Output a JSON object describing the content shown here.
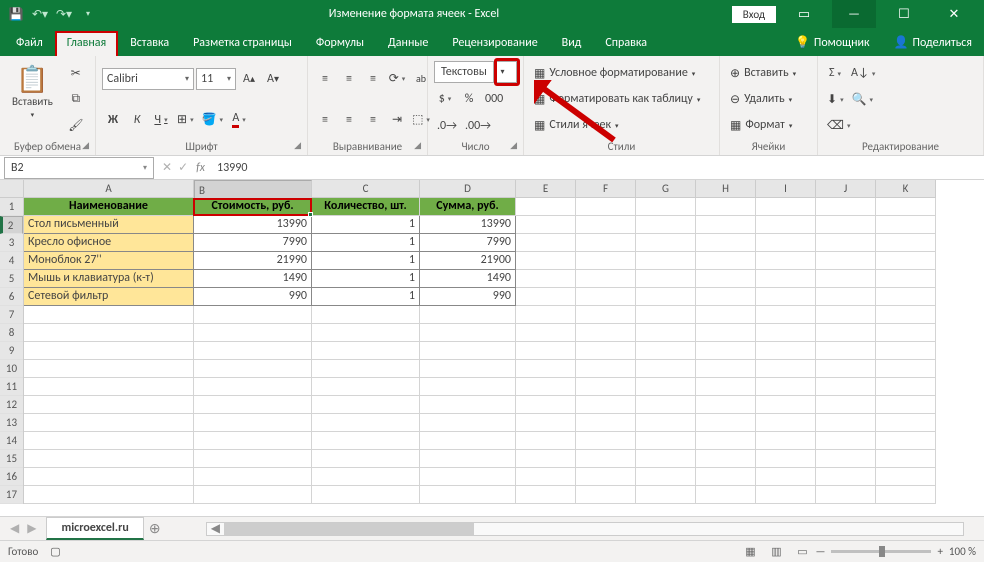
{
  "title": "Изменение формата ячеек  -  Excel",
  "login": "Вход",
  "tabs": {
    "file": "Файл",
    "home": "Главная",
    "insert": "Вставка",
    "layout": "Разметка страницы",
    "formulas": "Формулы",
    "data": "Данные",
    "review": "Рецензирование",
    "view": "Вид",
    "help": "Справка",
    "tell": "Помощник",
    "share": "Поделиться"
  },
  "ribbon": {
    "clipboard": {
      "paste": "Вставить",
      "label": "Буфер обмена"
    },
    "font": {
      "name": "Calibri",
      "size": "11",
      "label": "Шрифт",
      "bold": "Ж",
      "italic": "К",
      "underline": "Ч"
    },
    "align": {
      "label": "Выравнивание"
    },
    "number": {
      "format": "Текстовы",
      "label": "Число"
    },
    "styles": {
      "cond": "Условное форматирование",
      "table": "Форматировать как таблицу",
      "cell": "Стили ячеек",
      "label": "Стили"
    },
    "cells": {
      "insert": "Вставить",
      "delete": "Удалить",
      "format": "Формат",
      "label": "Ячейки"
    },
    "editing": {
      "label": "Редактирование"
    }
  },
  "formula": {
    "ref": "B2",
    "value": "13990"
  },
  "cols": [
    "A",
    "B",
    "C",
    "D",
    "E",
    "F",
    "G",
    "H",
    "I",
    "J",
    "K"
  ],
  "headers": [
    "Наименование",
    "Стоимость, руб.",
    "Количество, шт.",
    "Сумма, руб."
  ],
  "rows": [
    {
      "n": "Стол письменный",
      "c": "13990",
      "q": "1",
      "s": "13990"
    },
    {
      "n": "Кресло офисное",
      "c": "7990",
      "q": "1",
      "s": "7990"
    },
    {
      "n": "Моноблок 27''",
      "c": "21990",
      "q": "1",
      "s": "21900"
    },
    {
      "n": "Мышь и клавиатура (к-т)",
      "c": "1490",
      "q": "1",
      "s": "1490"
    },
    {
      "n": "Сетевой фильтр",
      "c": "990",
      "q": "1",
      "s": "990"
    }
  ],
  "sheet": "microexcel.ru",
  "status": {
    "ready": "Готово",
    "zoom": "100 %"
  }
}
